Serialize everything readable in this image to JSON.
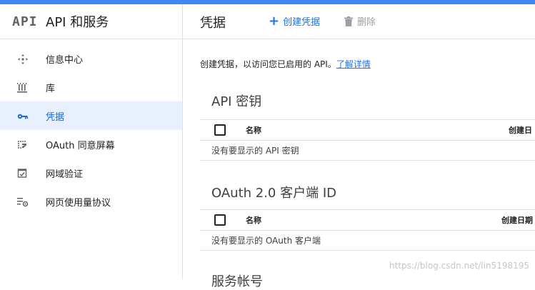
{
  "header": {
    "logo": "API",
    "product_title": "API 和服务"
  },
  "sidebar": {
    "items": [
      {
        "label": "信息中心",
        "icon": "dashboard-icon",
        "active": false
      },
      {
        "label": "库",
        "icon": "library-icon",
        "active": false
      },
      {
        "label": "凭据",
        "icon": "key-icon",
        "active": true
      },
      {
        "label": "OAuth 同意屏幕",
        "icon": "consent-screen-icon",
        "active": false
      },
      {
        "label": "网域验证",
        "icon": "domain-verification-icon",
        "active": false
      },
      {
        "label": "网页使用量协议",
        "icon": "page-usage-icon",
        "active": false
      }
    ]
  },
  "main": {
    "title": "凭据",
    "create_label": "创建凭据",
    "delete_label": "删除",
    "intro_text": "创建凭据，以访问您已启用的 API。",
    "learn_more": "了解详情",
    "sections": [
      {
        "title": "API 密钥",
        "col_name": "名称",
        "col_date": "创建日",
        "empty": "没有要显示的 API 密钥"
      },
      {
        "title": "OAuth 2.0 客户端 ID",
        "col_name": "名称",
        "col_date": "创建日期",
        "empty": "没有要显示的 OAuth 客户端"
      },
      {
        "title": "服务帐号"
      }
    ]
  },
  "watermark": "https://blog.csdn.net/lin5198195",
  "colors": {
    "accent": "#1a73e8",
    "active_bg": "#e8f0fe",
    "topbar": "#4285f4"
  }
}
